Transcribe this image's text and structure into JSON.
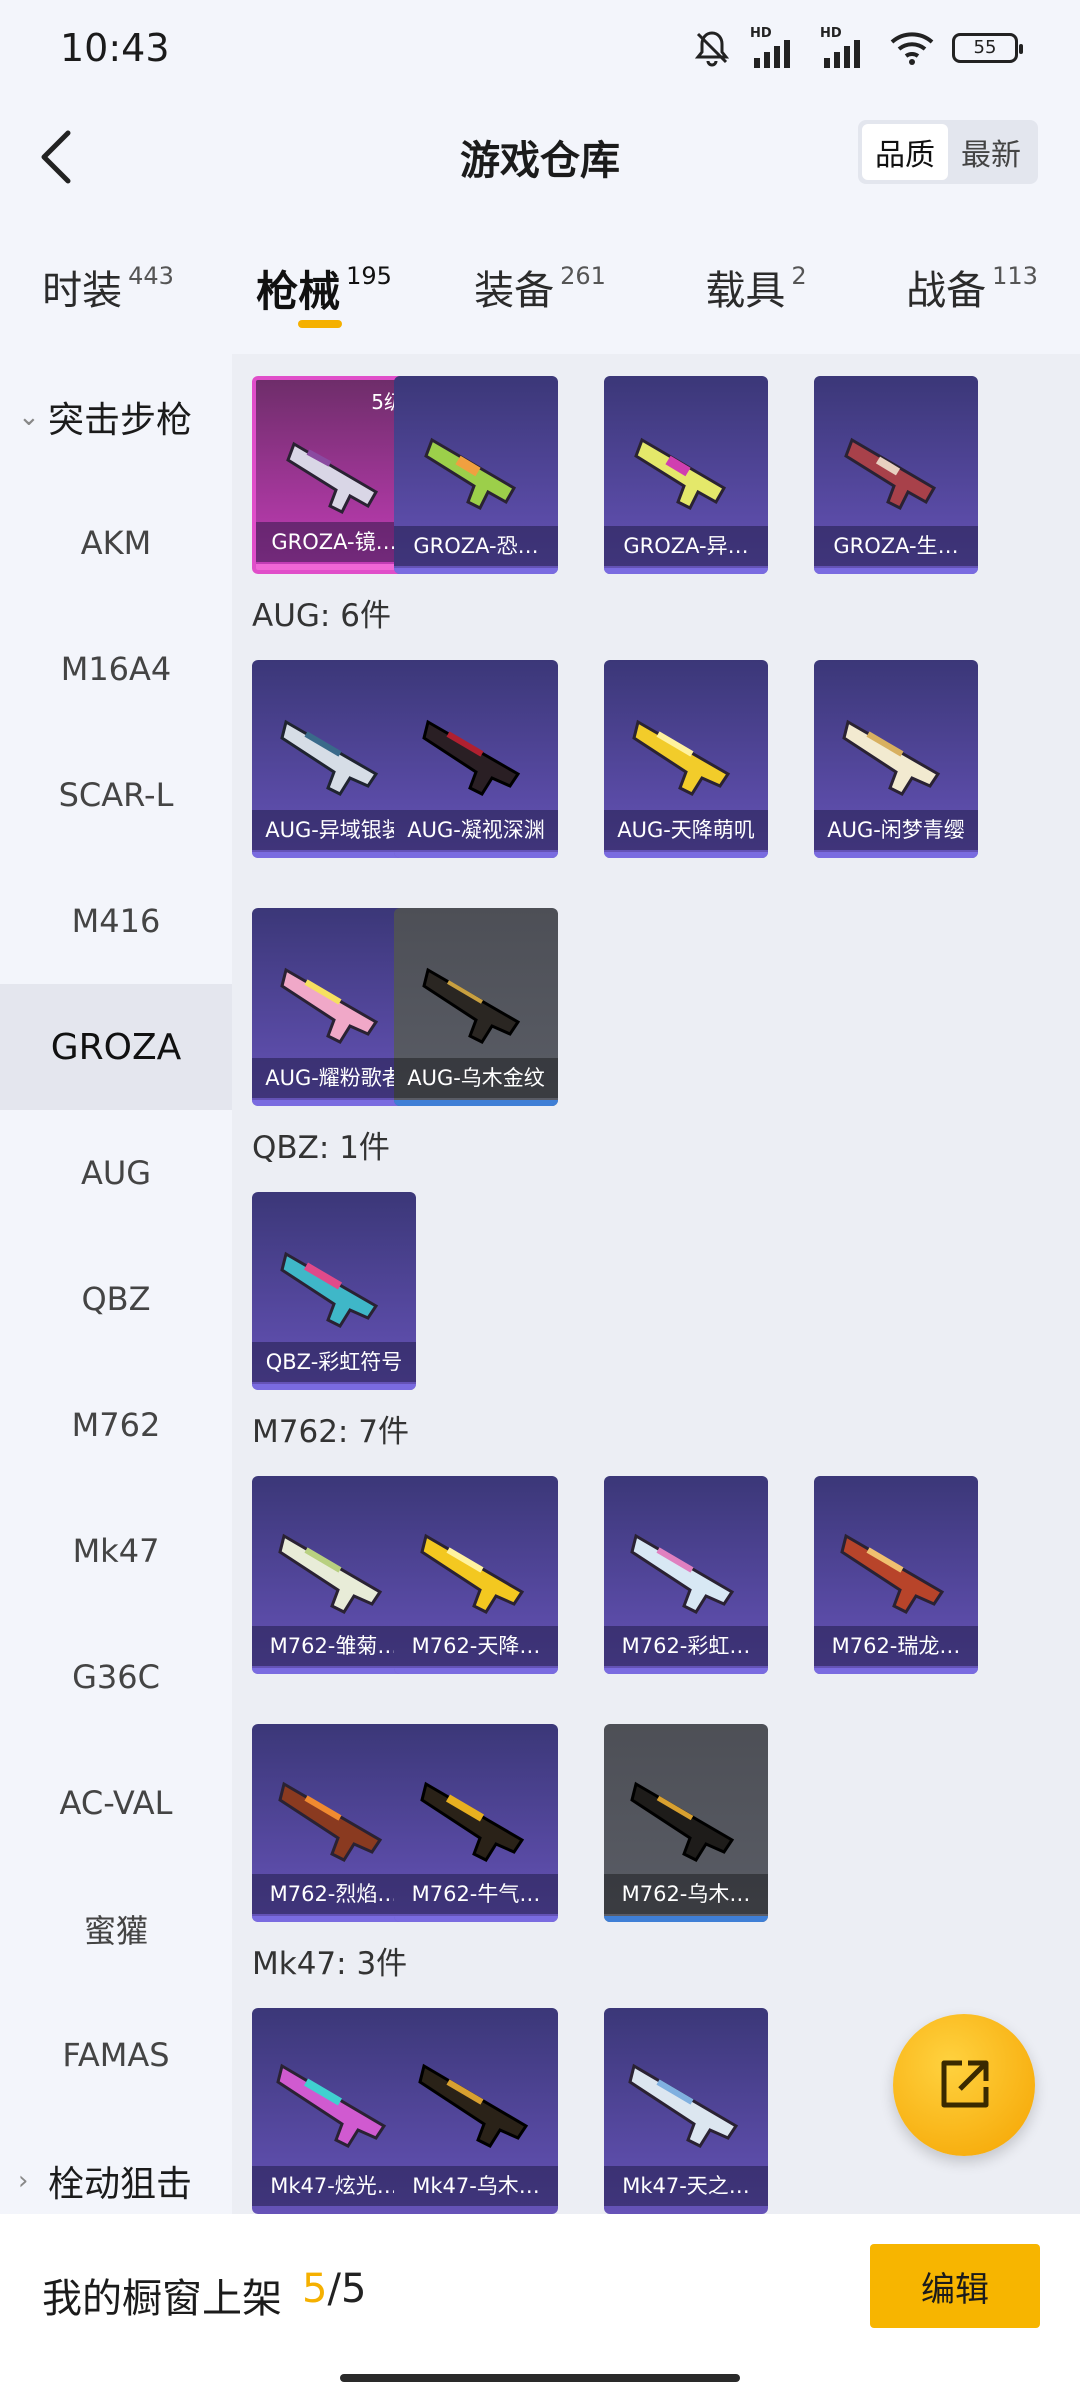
{
  "status": {
    "time": "10:43",
    "hd1": "HD",
    "hd2": "HD",
    "battery": "55"
  },
  "header": {
    "title": "游戏仓库",
    "sort_quality": "品质",
    "sort_latest": "最新"
  },
  "tabs": [
    {
      "label": "时装",
      "count": "443"
    },
    {
      "label": "枪械",
      "count": "195"
    },
    {
      "label": "装备",
      "count": "261"
    },
    {
      "label": "载具",
      "count": "2"
    },
    {
      "label": "战备",
      "count": "113"
    }
  ],
  "sidenav": {
    "group_open": "突击步枪",
    "items": [
      "AKM",
      "M16A4",
      "SCAR-L",
      "M416",
      "GROZA",
      "AUG",
      "QBZ",
      "M762",
      "Mk47",
      "G36C",
      "AC-VAL",
      "蜜獾",
      "FAMAS"
    ],
    "group_closed": "栓动狙击"
  },
  "content": {
    "groza_grade": "5级",
    "groza_cards": [
      "GROZA-镜…",
      "GROZA-恐…",
      "GROZA-异…",
      "GROZA-生…"
    ],
    "aug_header": "AUG: 6件",
    "aug_cards": [
      "AUG-异域银装",
      "AUG-凝视深渊",
      "AUG-天降萌叽",
      "AUG-闲梦青缨",
      "AUG-耀粉歌者",
      "AUG-乌木金纹"
    ],
    "qbz_header": "QBZ: 1件",
    "qbz_cards": [
      "QBZ-彩虹符号"
    ],
    "m762_header": "M762: 7件",
    "m762_cards": [
      "M762-雏菊…",
      "M762-天降…",
      "M762-彩虹…",
      "M762-瑞龙…",
      "M762-烈焰…",
      "M762-牛气…",
      "M762-乌木…"
    ],
    "mk47_header": "Mk47: 3件",
    "mk47_cards": [
      "Mk47-炫光…",
      "Mk47-乌木…",
      "Mk47-天之…"
    ]
  },
  "colors": {
    "accent": "#f5b000",
    "card_purple": "#6653b8",
    "card_pink": "#c43db8",
    "card_gray": "#5a5d66"
  },
  "footer": {
    "label": "我的橱窗上架",
    "current": "5",
    "separator": "/",
    "total": "5",
    "edit_label": "编辑"
  }
}
